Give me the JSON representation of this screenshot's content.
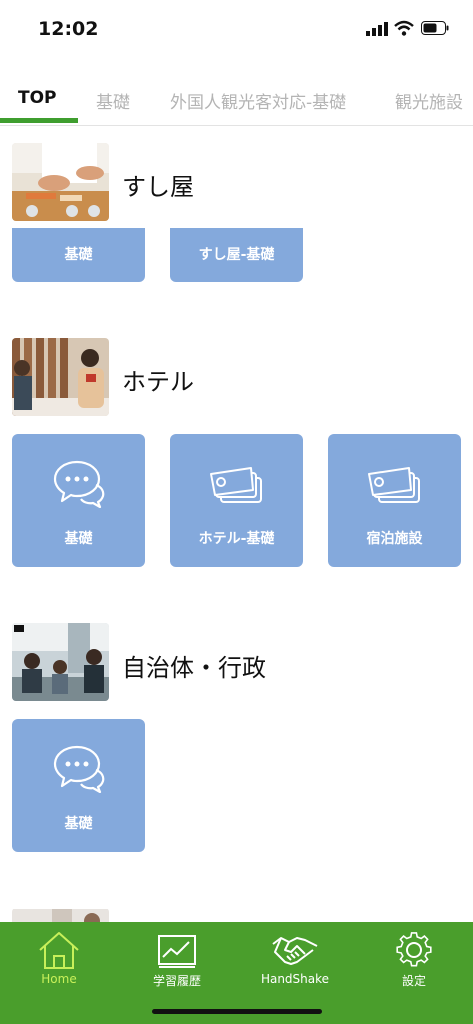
{
  "status_bar": {
    "time": "12:02"
  },
  "tabs": [
    {
      "label": "TOP",
      "active": true
    },
    {
      "label": "基礎",
      "active": false
    },
    {
      "label": "外国人観光客対応-基礎",
      "active": false
    },
    {
      "label": "観光施設",
      "active": false
    }
  ],
  "sections": [
    {
      "title": "すし屋",
      "cards": [
        {
          "label": "基礎"
        },
        {
          "label": "すし屋-基礎"
        }
      ]
    },
    {
      "title": "ホテル",
      "cards": [
        {
          "label": "基礎",
          "icon": "chat-bubbles-icon"
        },
        {
          "label": "ホテル-基礎",
          "icon": "tickets-icon"
        },
        {
          "label": "宿泊施設",
          "icon": "tickets-icon"
        }
      ]
    },
    {
      "title": "自治体・行政",
      "cards": [
        {
          "label": "基礎",
          "icon": "chat-bubbles-icon"
        }
      ]
    }
  ],
  "bottom_nav": [
    {
      "label": "Home",
      "icon": "home-icon",
      "active": true
    },
    {
      "label": "学習履歴",
      "icon": "chart-icon",
      "active": false
    },
    {
      "label": "HandShake",
      "icon": "handshake-icon",
      "active": false
    },
    {
      "label": "設定",
      "icon": "gear-icon",
      "active": false
    }
  ],
  "colors": {
    "accent": "#3f9e2f",
    "card": "#84a9dc",
    "nav_bg": "#4a9e2c",
    "nav_active": "#c8f05a"
  }
}
